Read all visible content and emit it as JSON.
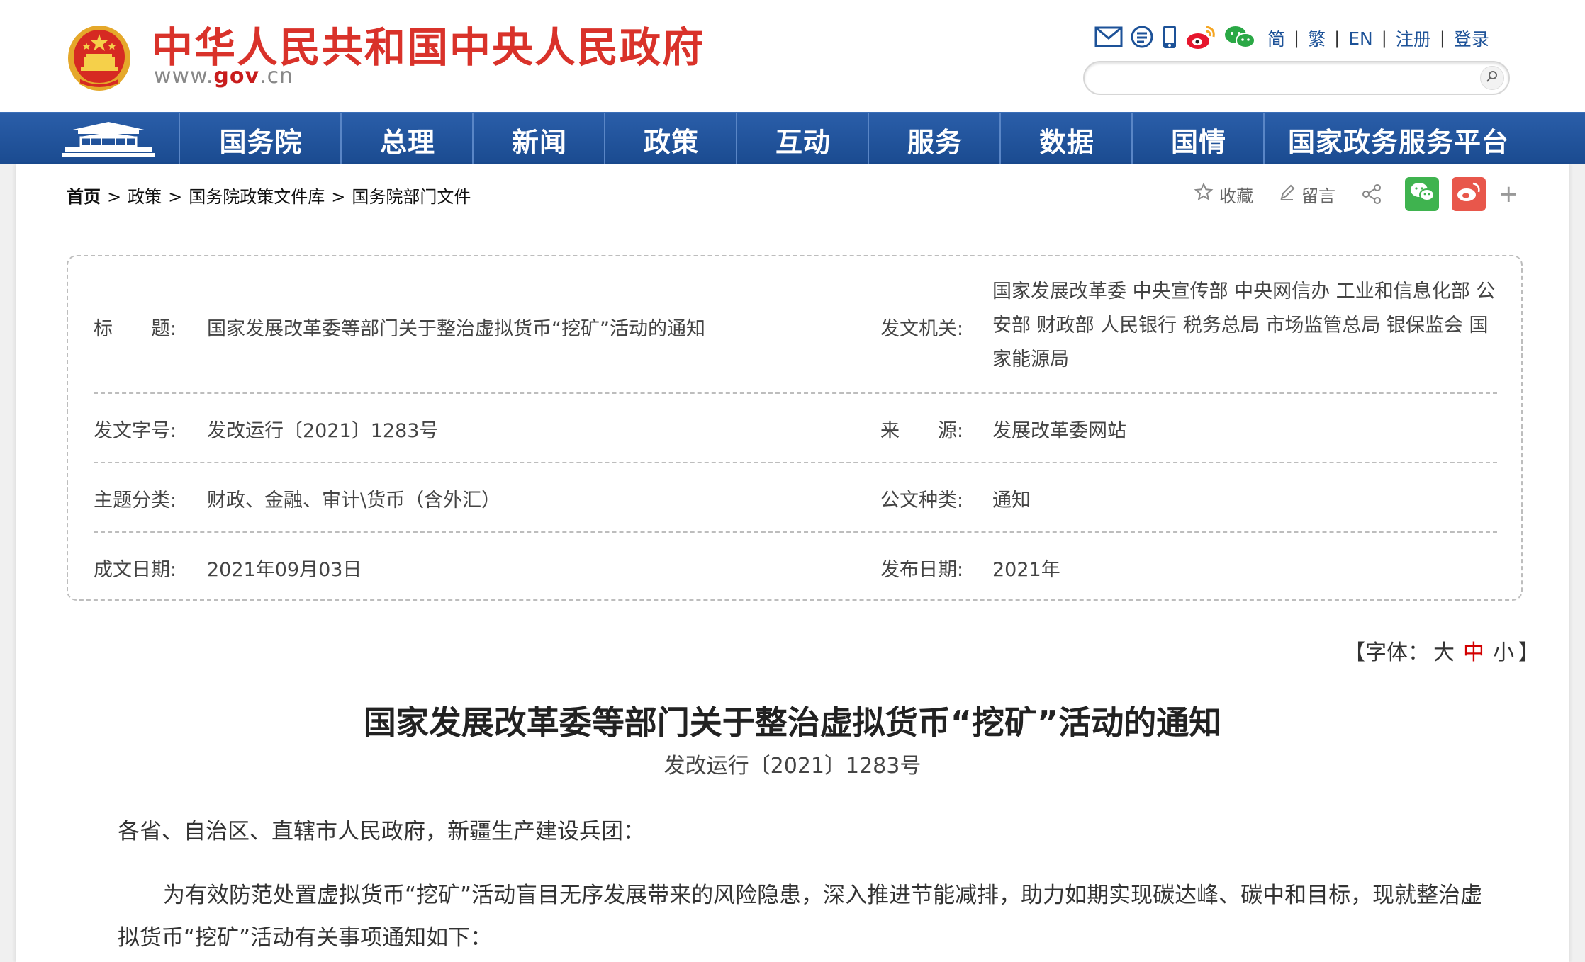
{
  "header": {
    "site_title": "中华人民共和国中央人民政府",
    "domain_prefix": "www.",
    "domain_main": "gov",
    "domain_suffix": ".cn",
    "top_icons": [
      "mail-icon",
      "message-icon",
      "mobile-icon",
      "weibo-icon",
      "wechat-icon"
    ],
    "lang_links": [
      "简",
      "繁",
      "EN",
      "注册",
      "登录"
    ],
    "search_placeholder": ""
  },
  "nav": {
    "items": [
      "国务院",
      "总理",
      "新闻",
      "政策",
      "互动",
      "服务",
      "数据",
      "国情",
      "国家政务服务平台"
    ]
  },
  "breadcrumb": {
    "items": [
      "首页",
      "政策",
      "国务院政策文件库",
      "国务院部门文件"
    ]
  },
  "share": {
    "favorite": "收藏",
    "comment": "留言"
  },
  "info": {
    "title_label": "标　　题:",
    "title_value": "国家发展改革委等部门关于整治虚拟货币“挖矿”活动的通知",
    "issuer_label": "发文机关:",
    "issuer_value": "国家发展改革委 中央宣传部 中央网信办 工业和信息化部 公安部 财政部 人民银行 税务总局 市场监管总局 银保监会 国家能源局",
    "docno_label": "发文字号:",
    "docno_value": "发改运行〔2021〕1283号",
    "source_label": "来　　源:",
    "source_value": "发展改革委网站",
    "topic_label": "主题分类:",
    "topic_value": "财政、金融、审计\\货币（含外汇）",
    "type_label": "公文种类:",
    "type_value": "通知",
    "written_label": "成文日期:",
    "written_value": "2021年09月03日",
    "published_label": "发布日期:",
    "published_value": "2021年"
  },
  "font_size": {
    "prefix": "【字体：",
    "large": "大",
    "medium": "中",
    "small": "小",
    "suffix": "】"
  },
  "document": {
    "title": "国家发展改革委等部门关于整治虚拟货币“挖矿”活动的通知",
    "number": "发改运行〔2021〕1283号",
    "salutation": "各省、自治区、直辖市人民政府，新疆生产建设兵团：",
    "paragraph": "为有效防范处置虚拟货币“挖矿”活动盲目无序发展带来的风险隐患，深入推进节能减排，助力如期实现碳达峰、碳中和目标，现就整治虚拟货币“挖矿”活动有关事项通知如下："
  },
  "colors": {
    "brand_red": "#d9322a",
    "nav_blue": "#1a4a8f",
    "link_blue": "#1d5298",
    "active_red": "#d20000"
  }
}
